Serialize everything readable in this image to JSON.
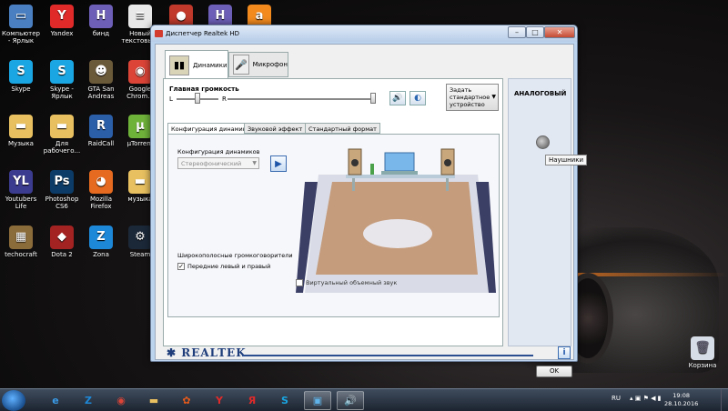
{
  "desktop": {
    "icons": [
      {
        "label": "Компьютер - Ярлык",
        "icon": "computer-icon",
        "color": "#4a7fc1",
        "glyph": "▭"
      },
      {
        "label": "Yandex",
        "icon": "yandex-icon",
        "color": "#e02a2a",
        "glyph": "Y"
      },
      {
        "label": "бинд",
        "icon": "document-icon",
        "color": "#6d5fb8",
        "glyph": "H"
      },
      {
        "label": "Новый текстовы...",
        "icon": "text-file-icon",
        "color": "#e8e8e8",
        "glyph": "≡"
      },
      {
        "label": "",
        "icon": "game-icon",
        "color": "#c0392b",
        "glyph": "●"
      },
      {
        "label": "",
        "icon": "document-icon",
        "color": "#6d5fb8",
        "glyph": "H"
      },
      {
        "label": "",
        "icon": "avast-icon",
        "color": "#f28a1e",
        "glyph": "a"
      },
      {
        "label": "Skype",
        "icon": "skype-icon",
        "color": "#19a6e3",
        "glyph": "S"
      },
      {
        "label": "Skype - Ярлык",
        "icon": "skype-icon",
        "color": "#19a6e3",
        "glyph": "S"
      },
      {
        "label": "GTA San Andreas",
        "icon": "gta-icon",
        "color": "#6b5a3a",
        "glyph": "☻"
      },
      {
        "label": "Google Chrom...",
        "icon": "chrome-icon",
        "color": "#db4437",
        "glyph": "◉"
      },
      {
        "label": "Музыка",
        "icon": "folder-icon",
        "color": "#e8c060",
        "glyph": "▬"
      },
      {
        "label": "Для рабочего...",
        "icon": "folder-icon",
        "color": "#e8c060",
        "glyph": "▬"
      },
      {
        "label": "RaidCall",
        "icon": "raidcall-icon",
        "color": "#2b5fa8",
        "glyph": "R"
      },
      {
        "label": "µTorrent",
        "icon": "utorrent-icon",
        "color": "#6fb23a",
        "glyph": "µ"
      },
      {
        "label": "Youtubers Life",
        "icon": "youtubers-life-icon",
        "color": "#3b3b8f",
        "glyph": "YL"
      },
      {
        "label": "Photoshop CS6",
        "icon": "photoshop-icon",
        "color": "#0b3b66",
        "glyph": "Ps"
      },
      {
        "label": "Mozilla Firefox",
        "icon": "firefox-icon",
        "color": "#e66a1f",
        "glyph": "◕"
      },
      {
        "label": "музыка",
        "icon": "folder-icon",
        "color": "#e8c060",
        "glyph": "▬"
      },
      {
        "label": "techocraft",
        "icon": "techocraft-icon",
        "color": "#8a6b3a",
        "glyph": "▦"
      },
      {
        "label": "Dota 2",
        "icon": "dota-icon",
        "color": "#a32222",
        "glyph": "◆"
      },
      {
        "label": "Zona",
        "icon": "zona-icon",
        "color": "#1e88d8",
        "glyph": "Z"
      },
      {
        "label": "Steam",
        "icon": "steam-icon",
        "color": "#1b2838",
        "glyph": "⚙"
      }
    ],
    "recycle_bin": "Корзина"
  },
  "window": {
    "title": "Диспетчер Realtek HD",
    "min_label": "–",
    "max_label": "□",
    "close_label": "✕",
    "device_tabs": [
      {
        "label": "Динамики",
        "icon": "speaker-icon"
      },
      {
        "label": "Микрофон",
        "icon": "microphone-icon"
      }
    ],
    "volume": {
      "title": "Главная громкость",
      "left": "L",
      "right": "R",
      "level_percent": 100,
      "balance_percent": 50
    },
    "set_default_label": "Задать стандартное устройство",
    "sub_tabs": [
      "Конфигурация динамиков",
      "Звуковой эффект",
      "Стандартный формат"
    ],
    "config": {
      "label": "Конфигурация динамиков",
      "selected": "Стереофонический",
      "wideband_label": "Широкополосные громкоговорители",
      "front_lr_label": "Передние левый и правый",
      "front_lr_checked": true,
      "virtual_surround_label": "Виртуальный объемный звук",
      "virtual_surround_checked": false
    },
    "right_panel": {
      "label": "АНАЛОГОВЫЙ",
      "tooltip": "Наушники"
    },
    "brand": "REALTEK",
    "ok_label": "OK"
  },
  "taskbar": {
    "items": [
      {
        "icon": "ie-icon",
        "glyph": "e",
        "color": "#3a9be8"
      },
      {
        "icon": "zona-icon",
        "glyph": "Z",
        "color": "#1e88d8"
      },
      {
        "icon": "chrome-icon",
        "glyph": "◉",
        "color": "#db4437"
      },
      {
        "icon": "folder-icon",
        "glyph": "▬",
        "color": "#e8c060"
      },
      {
        "icon": "media-icon",
        "glyph": "✿",
        "color": "#e85a1a"
      },
      {
        "icon": "yandex-icon",
        "glyph": "Y",
        "color": "#e02a2a"
      },
      {
        "icon": "yandex-browser-icon",
        "glyph": "Я",
        "color": "#e02a2a"
      },
      {
        "icon": "skype-icon",
        "glyph": "S",
        "color": "#19a6e3"
      },
      {
        "icon": "remote-icon",
        "glyph": "▣",
        "color": "#5fb3e8"
      },
      {
        "icon": "speaker-icon",
        "glyph": "🔊",
        "color": "#c0392b"
      }
    ],
    "lang": "RU",
    "time": "19:08",
    "date": "28.10.2016"
  }
}
